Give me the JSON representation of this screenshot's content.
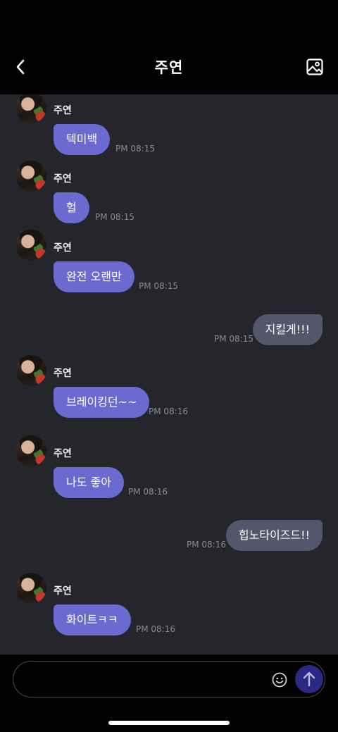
{
  "header": {
    "title": "주연",
    "back_icon": "chevron-left-icon",
    "gallery_icon": "image-icon"
  },
  "messages": [
    {
      "dir": "in",
      "sender": "주연",
      "text": "텍미백",
      "time": "PM 08:15"
    },
    {
      "dir": "in",
      "sender": "주연",
      "text": "헐",
      "time": "PM 08:15"
    },
    {
      "dir": "in",
      "sender": "주연",
      "text": "완전 오랜만",
      "time": "PM 08:15"
    },
    {
      "dir": "out",
      "text": "지킬게!!!",
      "time": "PM 08:15"
    },
    {
      "dir": "in",
      "sender": "주연",
      "text": "브레이킹던~~",
      "time": "PM 08:16"
    },
    {
      "dir": "in",
      "sender": "주연",
      "text": "나도 좋아",
      "time": "PM 08:16"
    },
    {
      "dir": "out",
      "text": "힙노타이즈드!!",
      "time": "PM 08:16"
    },
    {
      "dir": "in",
      "sender": "주연",
      "text": "화이트ㅋㅋ",
      "time": "PM 08:16"
    }
  ],
  "composer": {
    "placeholder": "",
    "value": "",
    "emoji_icon": "smiley-icon",
    "send_icon": "arrow-up-icon"
  },
  "colors": {
    "incoming_bubble": "#6b6ad0",
    "outgoing_bubble": "#55566c",
    "chat_background": "#25252c",
    "send_button": "#2a2a84"
  }
}
